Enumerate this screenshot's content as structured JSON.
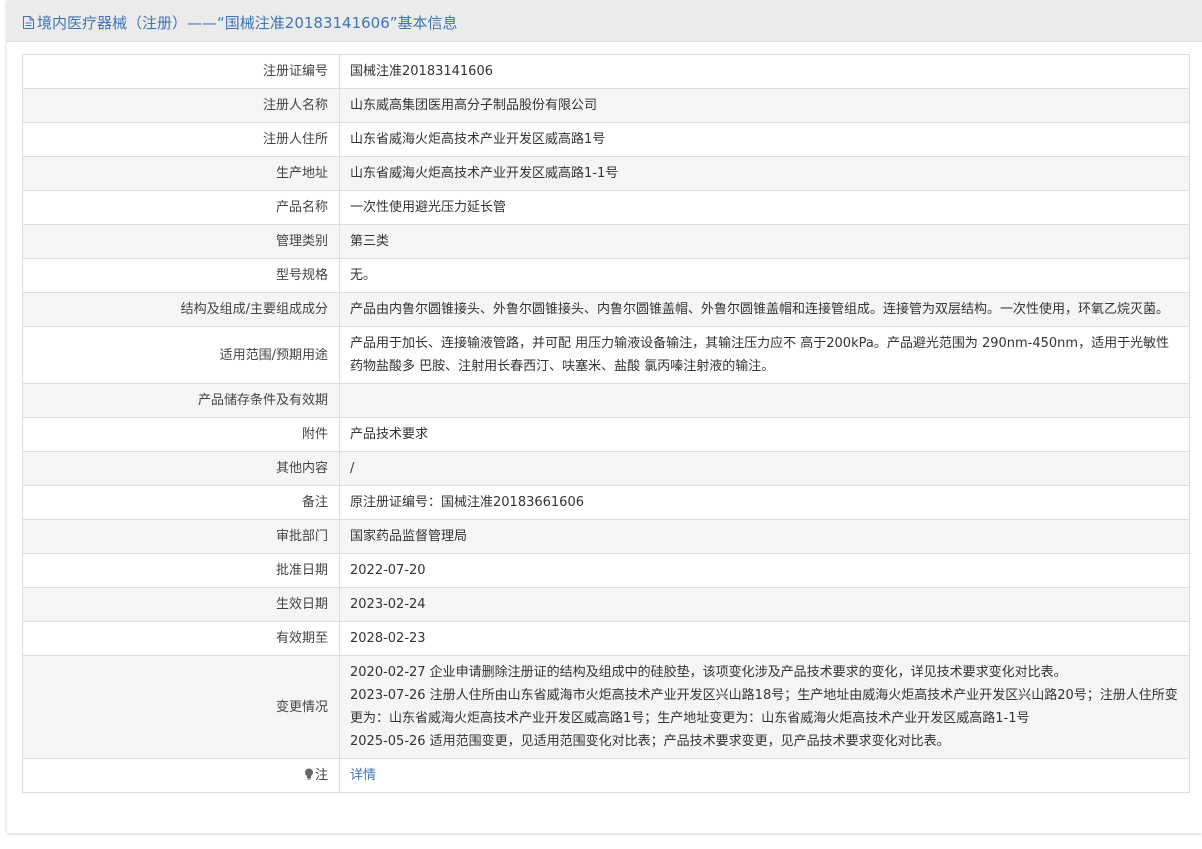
{
  "header": {
    "title": "境内医疗器械（注册）——“国械注准20183141606”基本信息",
    "icon": "document-icon",
    "accent_color": "#3f74b8"
  },
  "rows": [
    {
      "label": "注册证编号",
      "value": "国械注准20183141606"
    },
    {
      "label": "注册人名称",
      "value": "山东威高集团医用高分子制品股份有限公司"
    },
    {
      "label": "注册人住所",
      "value": "山东省威海火炬高技术产业开发区威高路1号"
    },
    {
      "label": "生产地址",
      "value": "山东省威海火炬高技术产业开发区威高路1-1号"
    },
    {
      "label": "产品名称",
      "value": "一次性使用避光压力延长管"
    },
    {
      "label": "管理类别",
      "value": "第三类"
    },
    {
      "label": "型号规格",
      "value": "无。"
    },
    {
      "label": "结构及组成/主要组成成分",
      "value": "产品由内鲁尔圆锥接头、外鲁尔圆锥接头、内鲁尔圆锥盖帽、外鲁尔圆锥盖帽和连接管组成。连接管为双层结构。一次性使用，环氧乙烷灭菌。"
    },
    {
      "label": "适用范围/预期用途",
      "value": "产品用于加长、连接输液管路，并可配 用压力输液设备输注，其输注压力应不 高于200kPa。产品避光范围为 290nm-450nm，适用于光敏性药物盐酸多 巴胺、注射用长春西汀、呋塞米、盐酸 氯丙嗪注射液的输注。"
    },
    {
      "label": "产品储存条件及有效期",
      "value": ""
    },
    {
      "label": "附件",
      "value": "产品技术要求"
    },
    {
      "label": "其他内容",
      "value": "/"
    },
    {
      "label": "备注",
      "value": "原注册证编号：国械注准20183661606"
    },
    {
      "label": "审批部门",
      "value": "国家药品监督管理局"
    },
    {
      "label": "批准日期",
      "value": "2022-07-20"
    },
    {
      "label": "生效日期",
      "value": "2023-02-24"
    },
    {
      "label": "有效期至",
      "value": "2028-02-23"
    }
  ],
  "changes": {
    "label": "变更情况",
    "entries": [
      "2020-02-27 企业申请删除注册证的结构及组成中的硅胶垫，该项变化涉及产品技术要求的变化，详见技术要求变化对比表。",
      "2023-07-26 注册人住所由山东省威海市火炬高技术产业开发区兴山路18号；生产地址由威海火炬高技术产业开发区兴山路20号；注册人住所变更为：山东省威海火炬高技术产业开发区威高路1号；生产地址变更为：山东省威海火炬高技术产业开发区威高路1-1号",
      "2025-05-26 适用范围变更，见适用范围变化对比表；产品技术要求变更，见产品技术要求变化对比表。"
    ]
  },
  "note": {
    "label": "注",
    "icon": "lightbulb-icon",
    "link_text": "详情"
  }
}
